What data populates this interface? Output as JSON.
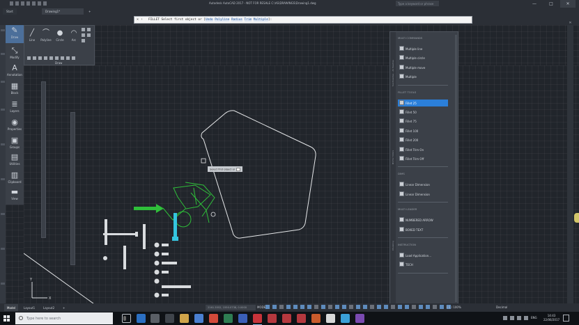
{
  "window": {
    "title": "Autodesk AutoCAD 2017 - NOT FOR RESALE   C:\\AS\\DRAWINGS\\Drawing1.dwg",
    "search_placeholder": "Type a keyword or phrase",
    "minimize": "—",
    "maximize": "□",
    "close": "✕"
  },
  "tabs": {
    "start": "Start",
    "doc": "Drawing1*",
    "new": "+"
  },
  "command_line": {
    "prompt": "FILLET Select first object or [",
    "options": [
      "Undo",
      "Polyline",
      "Radius",
      "Trim",
      "Multiple"
    ],
    "end": "]:"
  },
  "left_panel": {
    "items": [
      {
        "label": "Draw",
        "icon": "draw-icon",
        "glyph": "✎"
      },
      {
        "label": "Modify",
        "icon": "modify-icon",
        "glyph": "⤡"
      },
      {
        "label": "Annotation",
        "icon": "annotation-icon",
        "glyph": "A"
      },
      {
        "label": "Block",
        "icon": "block-icon",
        "glyph": "▦"
      },
      {
        "label": "Layers",
        "icon": "layers-icon",
        "glyph": "≣"
      },
      {
        "label": "Properties",
        "icon": "properties-icon",
        "glyph": "◉"
      },
      {
        "label": "Groups",
        "icon": "groups-icon",
        "glyph": "▣"
      },
      {
        "label": "Utilities",
        "icon": "utilities-icon",
        "glyph": "▤"
      },
      {
        "label": "Clipboard",
        "icon": "clipboard-icon",
        "glyph": "▥"
      },
      {
        "label": "View",
        "icon": "view-icon",
        "glyph": "▬"
      }
    ]
  },
  "draw_panel": {
    "tools": [
      {
        "label": "Line",
        "icon": "line-icon",
        "glyph": "╱"
      },
      {
        "label": "Polyline",
        "icon": "polyline-icon",
        "glyph": "⌒"
      },
      {
        "label": "Circle",
        "icon": "circle-icon",
        "glyph": "●"
      },
      {
        "label": "Arc",
        "icon": "arc-icon",
        "glyph": "◠"
      }
    ],
    "caption": "Draw"
  },
  "canvas": {
    "tooltip": "Select first object or"
  },
  "tool_palette": {
    "sections": [
      {
        "header": "MULTI COMMANDS",
        "items": [
          "Multiple line",
          "Multiple circle",
          "Multiple move",
          "Multiple"
        ],
        "selected": -1
      },
      {
        "header": "FILLET TOOLS",
        "items": [
          "Fillet 25",
          "Fillet 50",
          "Fillet 75",
          "Fillet 100",
          "Fillet 200",
          "Fillet Trim On",
          "Fillet Trim Off"
        ],
        "selected": 0
      },
      {
        "header": "DIMS",
        "items": [
          "Linear Dimension",
          "Linear Dimension"
        ],
        "selected": -1
      },
      {
        "header": "MULTI LEADER",
        "items": [
          "NUMBERED ARROW",
          "BOXED TEXT"
        ],
        "selected": -1
      },
      {
        "header": "INSTRUCTION",
        "items": [
          "Load Application...",
          "TECH"
        ],
        "selected": -1
      }
    ],
    "side_labels": [
      "Tool Palettes - All Palettes",
      "MSTSI TOOLS",
      "Modeling"
    ]
  },
  "status_bar": {
    "layout_tabs": [
      "Model",
      "Layout1",
      "Layout2"
    ],
    "add": "+",
    "coords": "2161.3552, 1550.0738, 0.0000",
    "model": "MODEL",
    "scale": "1:1 / 100%",
    "units": "Decimal"
  },
  "taskbar": {
    "search_placeholder": "Type here to search",
    "lang": "ENG",
    "time": "14:43",
    "date": "22/06/2017"
  },
  "colors": {
    "canvas": "#21252b",
    "panel": "#3b4048",
    "selection": "#2b7fd9",
    "accent_green": "#2fbf3a",
    "accent_cyan": "#34c6e0"
  }
}
